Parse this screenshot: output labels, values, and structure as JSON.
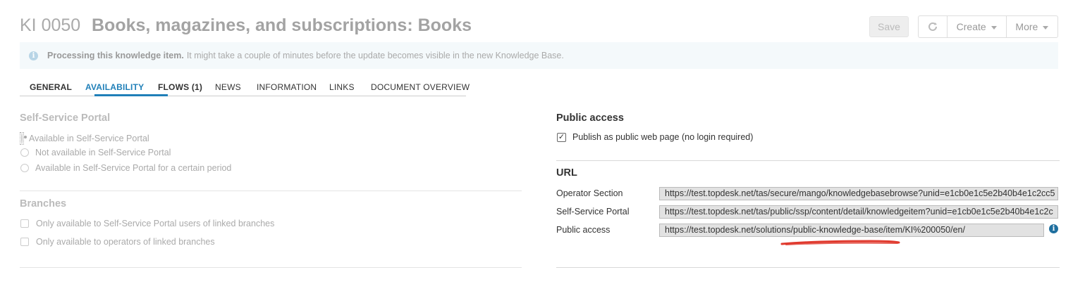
{
  "header": {
    "ki_id": "KI 0050",
    "title": "Books, magazines, and subscriptions: Books",
    "save_label": "Save",
    "refresh_icon": "refresh-icon",
    "create_label": "Create",
    "more_label": "More"
  },
  "banner": {
    "icon": "info-icon",
    "bold_text": "Processing this knowledge item.",
    "text": "It might take a couple of minutes before the update becomes visible in the new Knowledge Base."
  },
  "tabs": [
    {
      "label": "GENERAL"
    },
    {
      "label": "AVAILABILITY"
    },
    {
      "label": "FLOWS (1)"
    },
    {
      "label": "NEWS"
    },
    {
      "label": "INFORMATION"
    },
    {
      "label": "LINKS"
    },
    {
      "label": "DOCUMENT OVERVIEW"
    }
  ],
  "active_tab": "AVAILABILITY",
  "ssp": {
    "title": "Self-Service Portal",
    "options": [
      {
        "label": "Available in Self-Service Portal",
        "selected": true
      },
      {
        "label": "Not available in Self-Service Portal",
        "selected": false
      },
      {
        "label": "Available in Self-Service Portal for a certain period",
        "selected": false
      }
    ]
  },
  "branches": {
    "title": "Branches",
    "options": [
      {
        "label": "Only available to Self-Service Portal users of linked branches",
        "checked": false
      },
      {
        "label": "Only available to operators of linked branches",
        "checked": false
      }
    ]
  },
  "public_access": {
    "title": "Public access",
    "checkbox_label": "Publish as public web page (no login required)",
    "checked": true
  },
  "url": {
    "title": "URL",
    "rows": [
      {
        "label": "Operator Section",
        "value": "https://test.topdesk.net/tas/secure/mango/knowledgebasebrowse?unid=e1cb0e1c5e2b40b4e1c2cc5"
      },
      {
        "label": "Self-Service Portal",
        "value": "https://test.topdesk.net/tas/public/ssp/content/detail/knowledgeitem?unid=e1cb0e1c5e2b40b4e1c2c"
      },
      {
        "label": "Public access",
        "value": "https://test.topdesk.net/solutions/public-knowledge-base/item/KI%200050/en/"
      }
    ],
    "info_icon": "info-icon"
  },
  "colors": {
    "accent": "#1f7fb8",
    "annotation": "#e03a2e"
  }
}
